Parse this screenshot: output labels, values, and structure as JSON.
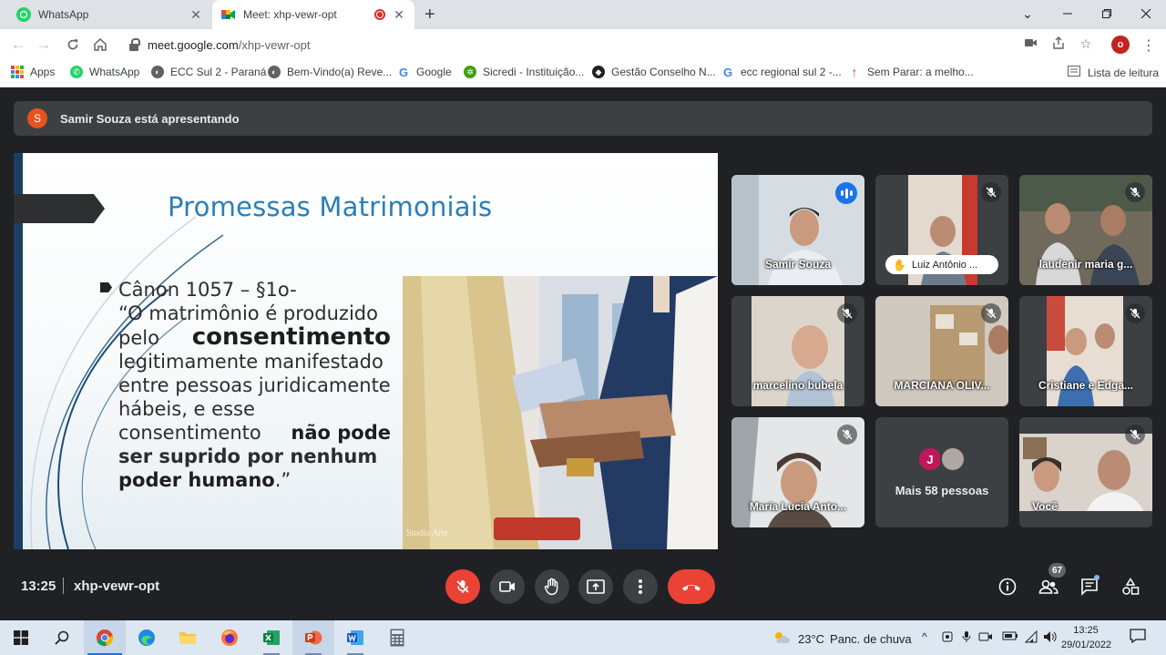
{
  "browser": {
    "tabs": [
      {
        "title": "WhatsApp",
        "active": false
      },
      {
        "title": "Meet: xhp-vewr-opt",
        "active": true
      }
    ],
    "url_host": "meet.google.com",
    "url_path": "/xhp-vewr-opt",
    "profile_initial": "o",
    "bookmarks": [
      "Apps",
      "WhatsApp",
      "ECC Sul 2 - Paraná",
      "Bem-Vindo(a) Reve...",
      "Google",
      "Sicredi - Instituição...",
      "Gestão Conselho N...",
      "ecc regional sul 2 -...",
      "Sem Parar: a melho..."
    ],
    "reading_list": "Lista de leitura"
  },
  "meet": {
    "presenter_initial": "S",
    "presenter_banner": "Samir Souza está apresentando",
    "slide": {
      "title": "Promessas Matrimoniais",
      "line1": "Cânon 1057 – §1o-",
      "line2": "“O matrimônio é produzido",
      "line3a": "pelo",
      "line3b": "consentimento",
      "line4": "legitimamente manifestado",
      "line5": "entre pessoas juridicamente",
      "line6": "hábeis, e esse",
      "line7a": "consentimento",
      "line7b": "não pode",
      "line8": "ser suprido por nenhum",
      "line9a": "poder humano",
      "line9b": ".”",
      "logo": "Studio Arte"
    },
    "participants": [
      {
        "name": "Samir Souza"
      },
      {
        "name": "Luiz Antônio ..."
      },
      {
        "name": "laudenir maria g..."
      },
      {
        "name": "marcelino bubela"
      },
      {
        "name": "MARCIANA OLIV..."
      },
      {
        "name": "Cristiane e Edga..."
      },
      {
        "name": "Maria Lucia Anto..."
      },
      {
        "name": "Mais 58 pessoas",
        "avatar_initial": "J"
      },
      {
        "name": "Você"
      }
    ],
    "clock": "13:25",
    "meeting_code": "xhp-vewr-opt",
    "people_count": "67"
  },
  "taskbar": {
    "weather_temp": "23°C",
    "weather_text": "Panc. de chuva",
    "time": "13:25",
    "date": "29/01/2022"
  },
  "colors": {
    "meet_bg": "#202124",
    "tile_bg": "#3c4043",
    "red": "#ea4335",
    "accent_blue": "#8ab4f8",
    "slide_title": "#2a7fb8"
  }
}
